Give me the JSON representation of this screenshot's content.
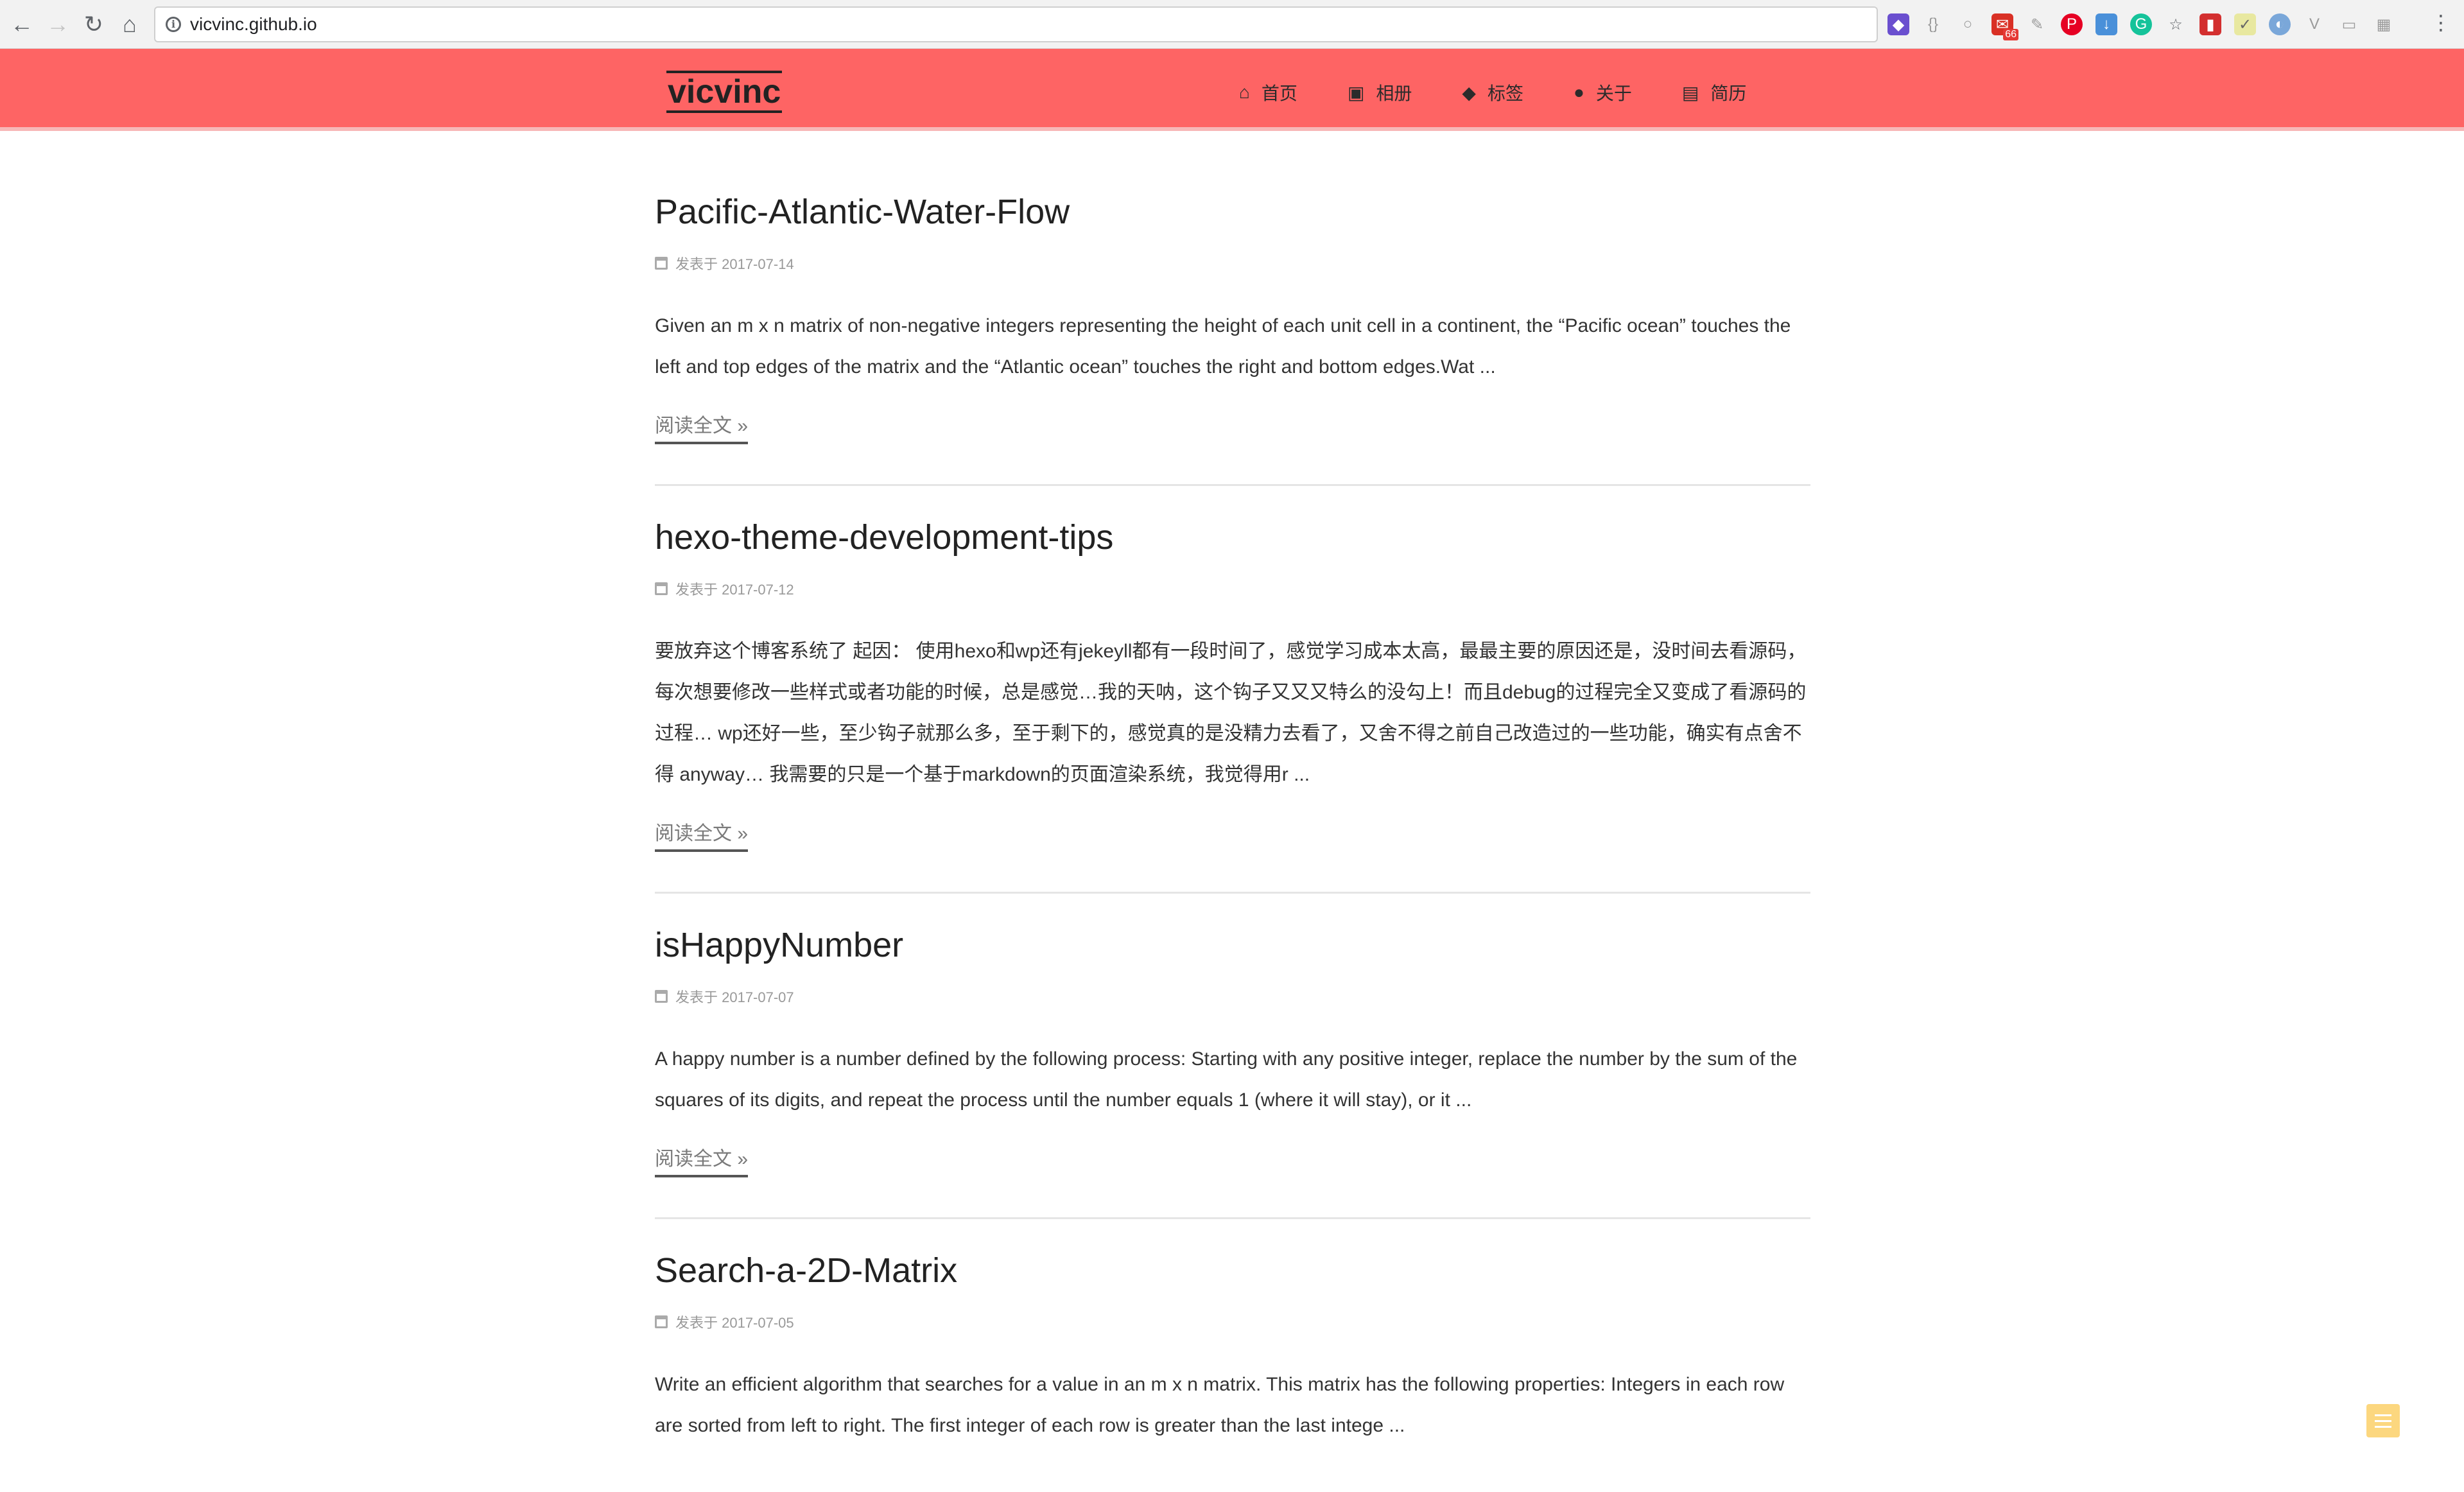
{
  "browser": {
    "url": "vicvinc.github.io",
    "extension_badge": "66"
  },
  "site": {
    "brand": "vicvinc",
    "menu": [
      {
        "icon": "home-icon",
        "glyph": "⌂",
        "label": "首页"
      },
      {
        "icon": "image-icon",
        "glyph": "▣",
        "label": "相册"
      },
      {
        "icon": "tags-icon",
        "glyph": "◆",
        "label": "标签"
      },
      {
        "icon": "user-icon",
        "glyph": "●",
        "label": "关于"
      },
      {
        "icon": "file-icon",
        "glyph": "▤",
        "label": "简历"
      }
    ]
  },
  "posts": [
    {
      "title": "Pacific-Atlantic-Water-Flow",
      "meta": "发表于 2017-07-14",
      "excerpt": "Given an m x n matrix of non-negative integers representing the height of each unit cell in a continent, the “Pacific ocean” touches the left and top edges of the matrix and the “Atlantic ocean” touches the right and bottom edges.Wat ...",
      "read_more": "阅读全文 »"
    },
    {
      "title": "hexo-theme-development-tips",
      "meta": "发表于 2017-07-12",
      "excerpt": "要放弃这个博客系统了 起因： 使用hexo和wp还有jekeyll都有一段时间了，感觉学习成本太高，最最主要的原因还是，没时间去看源码，每次想要修改一些样式或者功能的时候，总是感觉…我的天呐，这个钩子又又又特么的没勾上！而且debug的过程完全又变成了看源码的过程… wp还好一些，至少钩子就那么多，至于剩下的，感觉真的是没精力去看了，又舍不得之前自己改造过的一些功能，确实有点舍不得 anyway… 我需要的只是一个基于markdown的页面渲染系统，我觉得用r ...",
      "read_more": "阅读全文 »"
    },
    {
      "title": "isHappyNumber",
      "meta": "发表于 2017-07-07",
      "excerpt": "A happy number is a number defined by the following process: Starting with any positive integer, replace the number by the sum of the squares of its digits, and repeat the process until the number equals 1 (where it will stay), or it ...",
      "read_more": "阅读全文 »"
    },
    {
      "title": "Search-a-2D-Matrix",
      "meta": "发表于 2017-07-05",
      "excerpt": "Write an efficient algorithm that searches for a value in an m x n matrix. This matrix has the following properties: Integers in each row are sorted from left to right. The first integer of each row is greater than the last intege ...",
      "read_more": ""
    }
  ],
  "colors": {
    "header_bg": "#fe6464",
    "toc_button": "#fcd77f"
  }
}
